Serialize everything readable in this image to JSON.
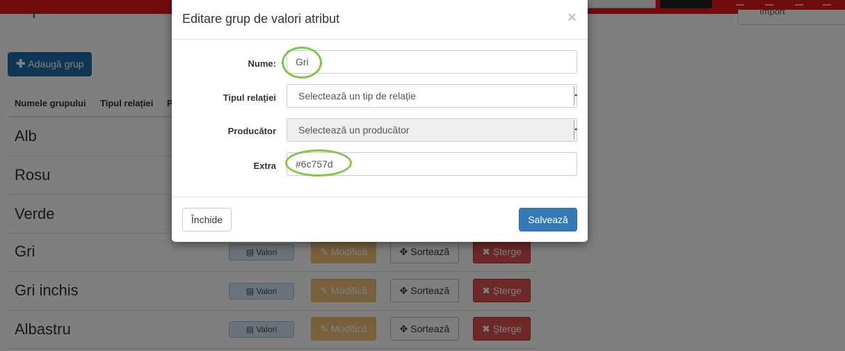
{
  "page": {
    "add_group_label": "Adaugă grup",
    "table": {
      "headers": [
        "Numele grupului",
        "Tipul relației",
        "P"
      ],
      "rows": [
        {
          "name": "Alb"
        },
        {
          "name": "Rosu"
        },
        {
          "name": "Verde"
        },
        {
          "name": "Gri"
        },
        {
          "name": "Gri inchis"
        },
        {
          "name": "Albastru"
        }
      ],
      "actions": {
        "values_label": "Valori",
        "edit_label": "Modifică",
        "sort_label": "Sortează",
        "delete_label": "Șterge"
      }
    }
  },
  "modal": {
    "title": "Editare grup de valori atribut",
    "close_symbol": "×",
    "fields": {
      "name": {
        "label": "Nume:",
        "value": "Gri"
      },
      "relation_type": {
        "label": "Tipul relației",
        "value": "Selectează un tip de relație"
      },
      "producer": {
        "label": "Producător",
        "value": "Selectează un producător"
      },
      "extra": {
        "label": "Extra",
        "value": "#6c757d"
      }
    },
    "close_button": "Închide",
    "save_button": "Salvează"
  },
  "colors": {
    "topbar": "#e5161a",
    "primary": "#337ab7",
    "highlight_ring": "#7fc74a",
    "warning": "#f0ad4e",
    "danger": "#d9534f"
  },
  "icons": {
    "plus": "plus-icon",
    "values": "list-icon",
    "edit": "pencil-icon",
    "sort": "move-icon",
    "delete": "remove-icon"
  }
}
